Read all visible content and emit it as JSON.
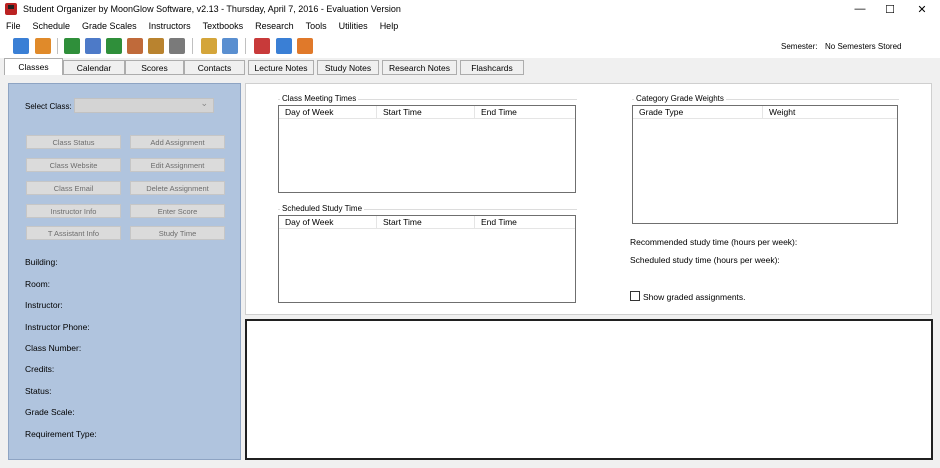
{
  "titlebar": {
    "title": "Student Organizer by MoonGlow Software, v2.13  -  Thursday, April 7, 2016  -  Evaluation Version",
    "minimize": "—",
    "maximize": "☐",
    "close": "✕"
  },
  "menu": [
    "File",
    "Schedule",
    "Grade Scales",
    "Instructors",
    "Textbooks",
    "Research",
    "Tools",
    "Utilities",
    "Help"
  ],
  "toolbar": {
    "icons": [
      {
        "name": "schedule-icon",
        "color": "#3a7fd5"
      },
      {
        "name": "edit-class-icon",
        "color": "#e08a2a"
      },
      {
        "name": "grade-scale-icon",
        "color": "#2f8f3a"
      },
      {
        "name": "notes-icon",
        "color": "#4d7ac8"
      },
      {
        "name": "textbooks-icon",
        "color": "#2f8f3a"
      },
      {
        "name": "calendar-icon",
        "color": "#c06a3a"
      },
      {
        "name": "planner-icon",
        "color": "#b9832f"
      },
      {
        "name": "alarm-clock-icon",
        "color": "#7a7a7a"
      },
      {
        "name": "write-notes-icon",
        "color": "#d4a53a"
      },
      {
        "name": "research-icon",
        "color": "#5a8fd0"
      },
      {
        "name": "tools-icon",
        "color": "#c83a3a"
      },
      {
        "name": "help-icon",
        "color": "#3a7fd5"
      },
      {
        "name": "exit-icon",
        "color": "#e0792a"
      }
    ],
    "semester_label": "Semester:",
    "semester_value": "No Semesters Stored"
  },
  "tabs": [
    "Classes",
    "Calendar",
    "Scores",
    "Contacts",
    "Lecture Notes",
    "Study Notes",
    "Research Notes",
    "Flashcards"
  ],
  "left": {
    "select_label": "Select Class:",
    "buttons": [
      "Class Status",
      "Add Assignment",
      "Class Website",
      "Edit Assignment",
      "Class Email",
      "Delete Assignment",
      "Instructor Info",
      "Enter Score",
      "T Assistant Info",
      "Study Time"
    ],
    "fields": [
      "Building:",
      "Room:",
      "Instructor:",
      "Instructor Phone:",
      "Class Number:",
      "Credits:",
      "Status:",
      "Grade Scale:",
      "Requirement Type:"
    ]
  },
  "main": {
    "meeting_title": "Class Meeting Times",
    "meeting_cols": [
      "Day of Week",
      "Start Time",
      "End Time"
    ],
    "study_title": "Scheduled Study Time",
    "study_cols": [
      "Day of Week",
      "Start Time",
      "End Time"
    ],
    "weights_title": "Category Grade Weights",
    "weights_cols": [
      "Grade Type",
      "Weight"
    ],
    "recommended": "Recommended study time (hours per week):",
    "scheduled": "Scheduled study time (hours per week):",
    "show_graded": "Show graded assignments."
  }
}
